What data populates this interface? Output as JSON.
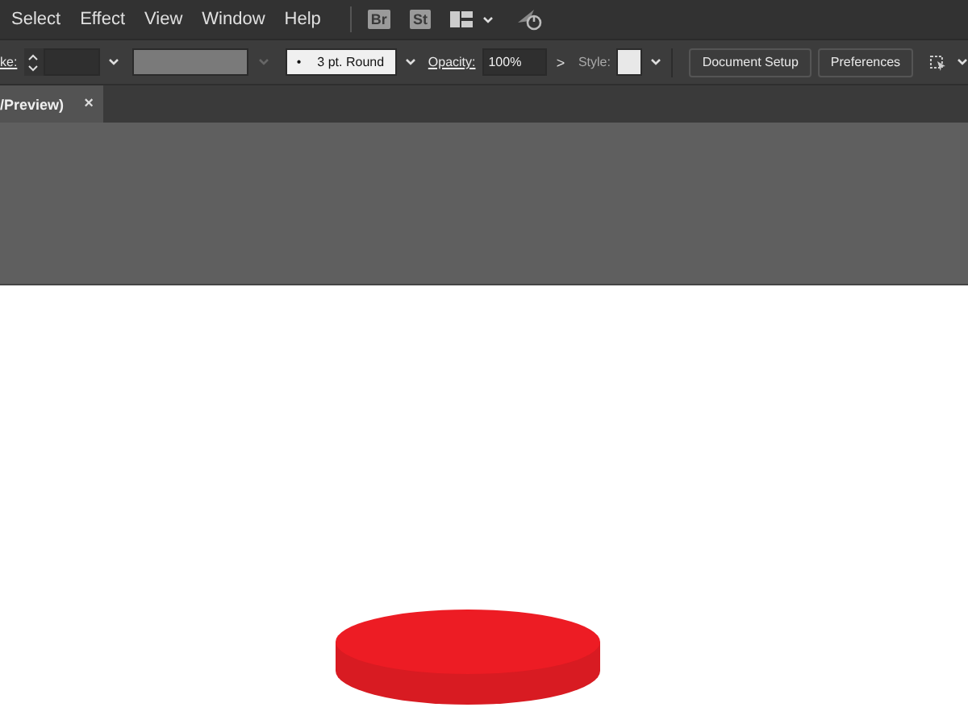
{
  "menu": [
    "Select",
    "Effect",
    "View",
    "Window",
    "Help"
  ],
  "app_buttons": [
    "Br",
    "St"
  ],
  "control_bar": {
    "stroke_label": "ke:",
    "brush_dot": "•",
    "brush": "3 pt. Round",
    "opacity_label": "Opacity:",
    "opacity": "100%",
    "opacity_arrow": ">",
    "style_label": "Style:",
    "buttons": [
      "Document Setup",
      "Preferences"
    ]
  },
  "tab": {
    "title": "/Preview)",
    "close": "×",
    "selected": true
  }
}
